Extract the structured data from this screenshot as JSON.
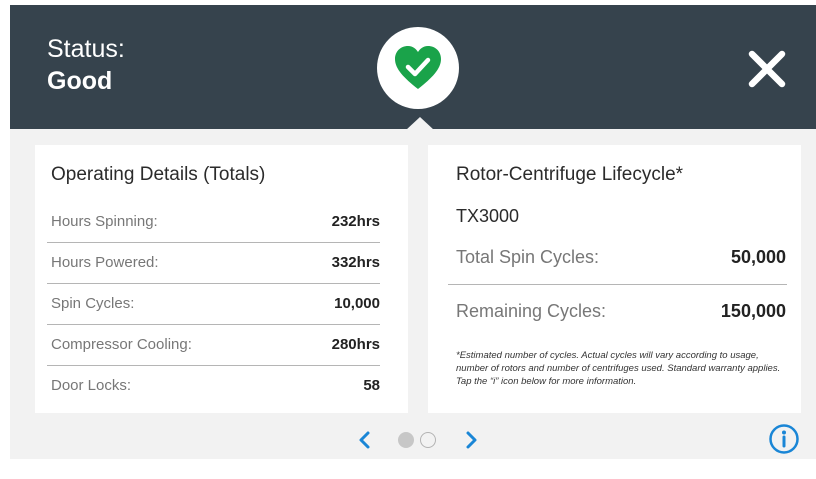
{
  "header": {
    "status_label": "Status:",
    "status_value": "Good",
    "status_icon": "heart-check-icon",
    "status_color": "#1aa34a",
    "background_color": "#36434d"
  },
  "operating_details": {
    "title": "Operating Details (Totals)",
    "rows": [
      {
        "label": "Hours Spinning:",
        "value": "232hrs"
      },
      {
        "label": "Hours Powered:",
        "value": "332hrs"
      },
      {
        "label": "Spin Cycles:",
        "value": "10,000"
      },
      {
        "label": "Compressor Cooling:",
        "value": "280hrs"
      },
      {
        "label": "Door Locks:",
        "value": "58"
      }
    ]
  },
  "lifecycle": {
    "title": "Rotor-Centrifuge Lifecycle*",
    "model": "TX3000",
    "total_label": "Total Spin Cycles:",
    "total_value": "50,000",
    "remaining_label": "Remaining Cycles:",
    "remaining_value": "150,000",
    "footnote": "*Estimated number of cycles. Actual cycles will vary according to usage, number of rotors and number of centrifuges used. Standard warranty applies. Tap the “i” icon below for more information."
  },
  "pager": {
    "current_page": 1,
    "total_pages": 2,
    "accent_color": "#1a86d6"
  }
}
